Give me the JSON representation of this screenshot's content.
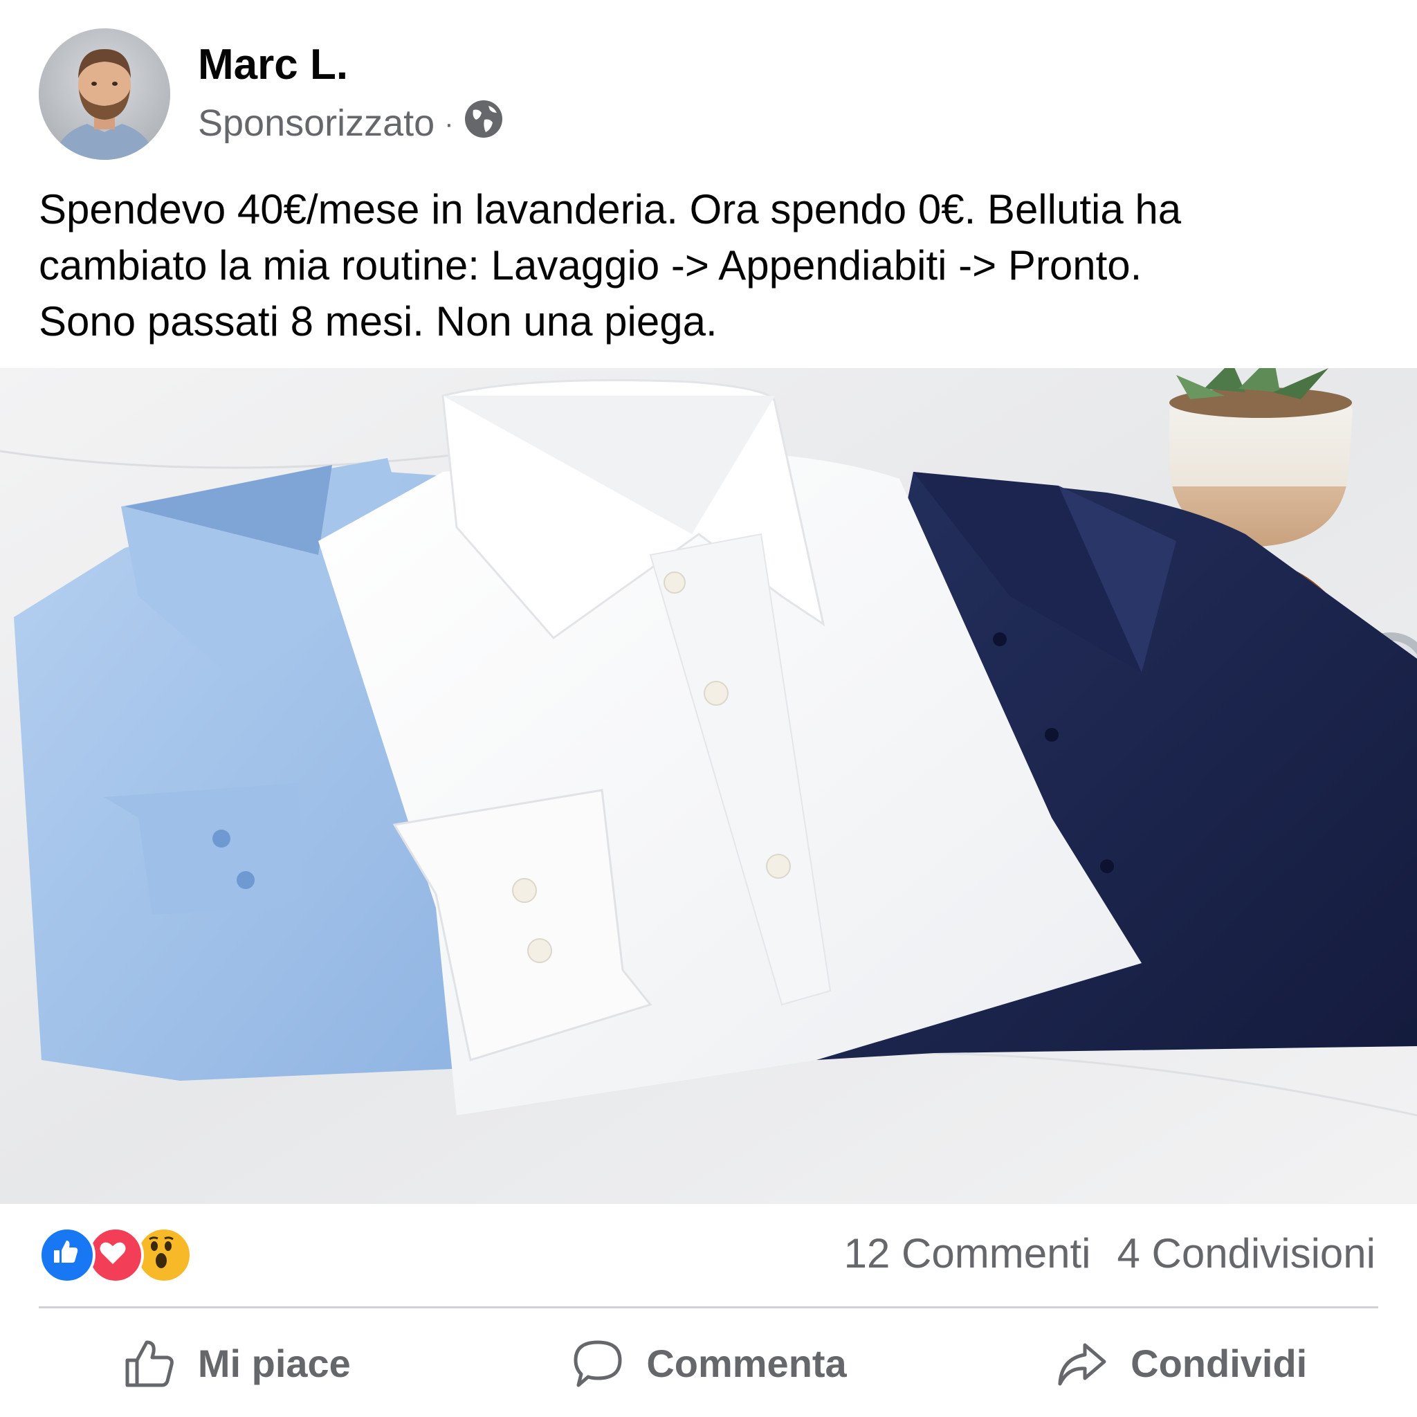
{
  "post": {
    "author": "Marc L.",
    "sponsored_label": "Sponsorizzato",
    "separator": "·",
    "audience_icon": "globe-icon",
    "text_lines": [
      "Spendevo 40€/mese in lavanderia. Ora spendo 0€. Bellutia ha",
      "cambiato la mia routine: Lavaggio -> Appendiabiti -> Pronto.",
      "Sono passati 8 mesi. Non una piega."
    ],
    "image": {
      "subject": "three folded dress shirts (light blue, white, navy) with a potted succulent and a leather-strap watch on a marble surface"
    }
  },
  "engagement": {
    "reactions": [
      "like-reaction-icon",
      "love-reaction-icon",
      "wow-reaction-icon"
    ],
    "comments": "12 Commenti",
    "shares": "4 Condivisioni"
  },
  "actions": {
    "like": "Mi piace",
    "comment": "Commenta",
    "share": "Condividi"
  },
  "colors": {
    "like_blue": "#1877f2",
    "love_red": "#f33e58",
    "wow_yellow": "#f7b928",
    "secondary_text": "#65676b",
    "divider": "#ced0d4"
  }
}
